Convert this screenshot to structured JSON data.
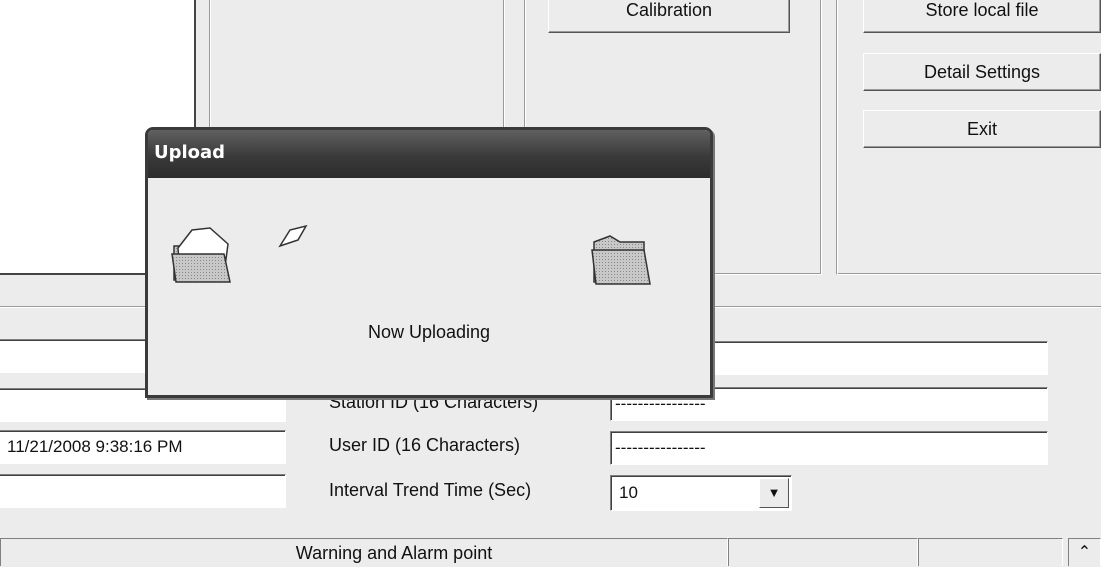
{
  "buttons": {
    "calibration": "Calibration",
    "store_local_file": "Store local file",
    "detail_settings": "Detail Settings",
    "exit": "Exit"
  },
  "dialog": {
    "title": "Upload",
    "message": "Now Uploading"
  },
  "left_fields": {
    "datetime": "11/21/2008 9:38:16 PM"
  },
  "form": {
    "station_id_label": "Station ID (16 Characters)",
    "station_id_value": "----------------",
    "user_id_label": "User ID (16 Characters)",
    "user_id_value": "----------------",
    "interval_label": "Interval Trend Time (Sec)",
    "interval_value": "10",
    "hidden_field_value": "----------------"
  },
  "status_bar": {
    "warning_text": "Warning and Alarm point"
  },
  "icons": {
    "source": "open-folder-icon",
    "flying": "document-icon",
    "destination": "closed-folder-icon",
    "dropdown": "triangle-down-icon",
    "scroll_up": "chevron-up-icon"
  }
}
